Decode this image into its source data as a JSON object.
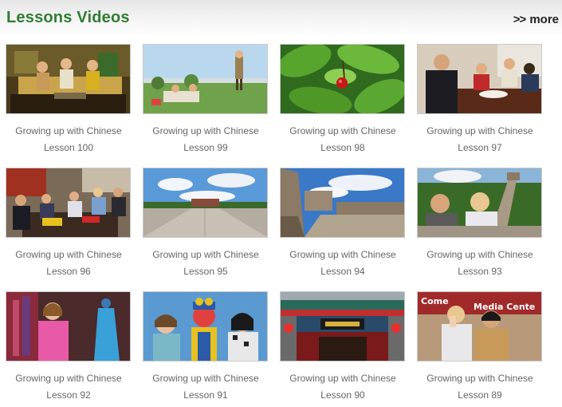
{
  "section": {
    "title": "Lessons Videos",
    "more_label": "more",
    "more_chevron": ">>",
    "title_color": "#2f7d32"
  },
  "videos": [
    {
      "series": "Growing up with Chinese",
      "lesson": "Lesson 100",
      "thumb": "living-room-sofa-scene"
    },
    {
      "series": "Growing up with Chinese",
      "lesson": "Lesson 99",
      "thumb": "park-picnic-scene"
    },
    {
      "series": "Growing up with Chinese",
      "lesson": "Lesson 98",
      "thumb": "cherry-tree-scene"
    },
    {
      "series": "Growing up with Chinese",
      "lesson": "Lesson 97",
      "thumb": "family-dinner-scene"
    },
    {
      "series": "Growing up with Chinese",
      "lesson": "Lesson 96",
      "thumb": "family-gathering-scene"
    },
    {
      "series": "Growing up with Chinese",
      "lesson": "Lesson 95",
      "thumb": "tiananmen-square-scene"
    },
    {
      "series": "Growing up with Chinese",
      "lesson": "Lesson 94",
      "thumb": "great-wall-walkway-scene"
    },
    {
      "series": "Growing up with Chinese",
      "lesson": "Lesson 93",
      "thumb": "great-wall-friends-scene"
    },
    {
      "series": "Growing up with Chinese",
      "lesson": "Lesson 92",
      "thumb": "qipao-shop-scene"
    },
    {
      "series": "Growing up with Chinese",
      "lesson": "Lesson 91",
      "thumb": "opera-mask-scene"
    },
    {
      "series": "Growing up with Chinese",
      "lesson": "Lesson 90",
      "thumb": "traditional-gate-scene"
    },
    {
      "series": "Growing up with Chinese",
      "lesson": "Lesson 89",
      "thumb": "media-center-friends-scene"
    }
  ]
}
